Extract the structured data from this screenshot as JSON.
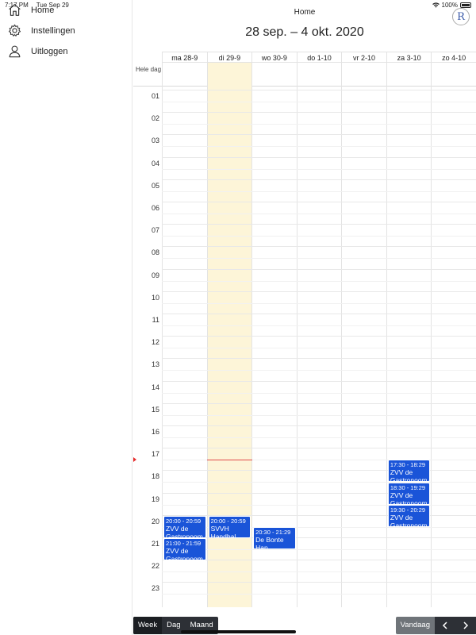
{
  "status_bar": {
    "time": "7:17 PM",
    "date": "Tue Sep 29",
    "battery": "100%"
  },
  "sidebar": {
    "items": [
      {
        "label": "Home",
        "icon": "home-icon"
      },
      {
        "label": "Instellingen",
        "icon": "gear-icon"
      },
      {
        "label": "Uitloggen",
        "icon": "user-icon"
      }
    ]
  },
  "header": {
    "title": "Home",
    "week_range": "28 sep. – 4 okt. 2020",
    "logo_letter": "R"
  },
  "calendar": {
    "all_day_label": "Hele dag",
    "days": [
      "ma 28-9",
      "di 29-9",
      "wo 30-9",
      "do 1-10",
      "vr 2-10",
      "za 3-10",
      "zo 4-10"
    ],
    "today_index": 1,
    "hours": [
      "01",
      "02",
      "03",
      "04",
      "05",
      "06",
      "07",
      "08",
      "09",
      "10",
      "11",
      "12",
      "13",
      "14",
      "15",
      "16",
      "17",
      "18",
      "19",
      "20",
      "21",
      "22",
      "23"
    ],
    "now_hour": 17.25,
    "events": [
      {
        "day": 0,
        "start": 20.0,
        "end": 21.0,
        "time": "20:00 - 20:59",
        "title": "ZVV de Gastronoom"
      },
      {
        "day": 0,
        "start": 21.0,
        "end": 22.0,
        "time": "21:00 - 21:59",
        "title": "ZVV de Gastronoom"
      },
      {
        "day": 1,
        "start": 20.0,
        "end": 21.0,
        "time": "20:00 - 20:59",
        "title": "SVVH Handbal"
      },
      {
        "day": 2,
        "start": 20.5,
        "end": 21.5,
        "time": "20:30 - 21:29",
        "title": "De Bonte Hap"
      },
      {
        "day": 5,
        "start": 17.5,
        "end": 18.5,
        "time": "17:30 - 18:29",
        "title": "ZVV de Gastronoom"
      },
      {
        "day": 5,
        "start": 18.5,
        "end": 19.5,
        "time": "18:30 - 19:29",
        "title": "ZVV de Gastronoom"
      },
      {
        "day": 5,
        "start": 19.5,
        "end": 20.5,
        "time": "19:30 - 20:29",
        "title": "ZVV de Gastronoom"
      }
    ]
  },
  "toolbar": {
    "views": [
      "Week",
      "Dag",
      "Maand"
    ],
    "active_view": "Week",
    "today_label": "Vandaag"
  },
  "colors": {
    "event": "#1a54d8",
    "today_column": "#fdf5d8",
    "now_line": "#e14b4b"
  }
}
